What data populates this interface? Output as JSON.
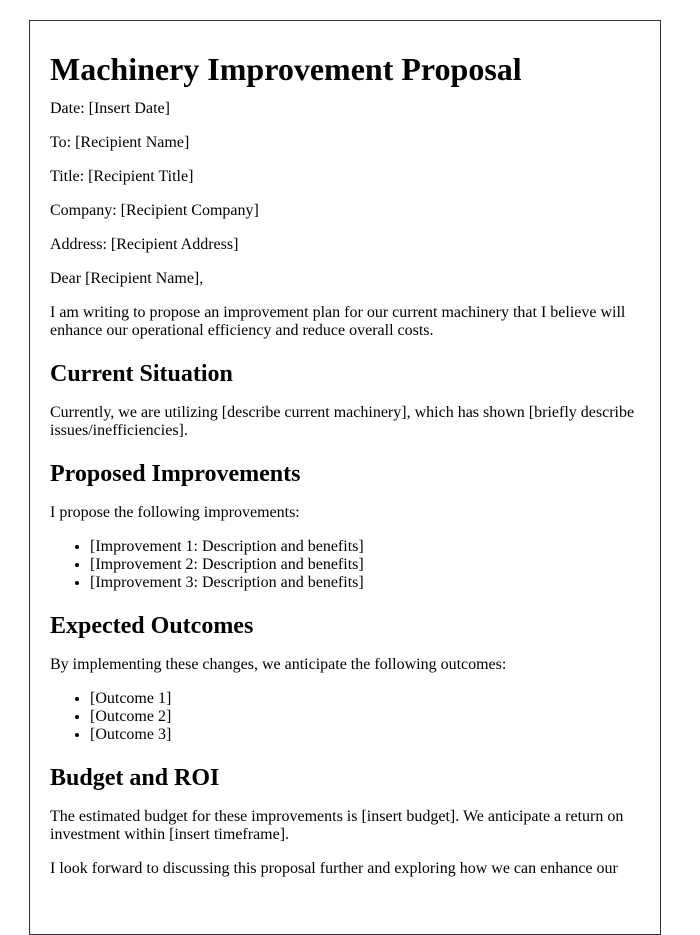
{
  "title": "Machinery Improvement Proposal",
  "meta": [
    "Date: [Insert Date]",
    "To: [Recipient Name]",
    "Title: [Recipient Title]",
    "Company: [Recipient Company]",
    "Address: [Recipient Address]"
  ],
  "salutation": "Dear [Recipient Name],",
  "intro": "I am writing to propose an improvement plan for our current machinery that I believe will enhance our operational efficiency and reduce overall costs.",
  "sections": {
    "current": {
      "heading": "Current Situation",
      "text": "Currently, we are utilizing [describe current machinery], which has shown [briefly describe issues/inefficiencies]."
    },
    "improvements": {
      "heading": "Proposed Improvements",
      "text": "I propose the following improvements:",
      "items": [
        "[Improvement 1: Description and benefits]",
        "[Improvement 2: Description and benefits]",
        "[Improvement 3: Description and benefits]"
      ]
    },
    "outcomes": {
      "heading": "Expected Outcomes",
      "text": "By implementing these changes, we anticipate the following outcomes:",
      "items": [
        "[Outcome 1]",
        "[Outcome 2]",
        "[Outcome 3]"
      ]
    },
    "budget": {
      "heading": "Budget and ROI",
      "text": "The estimated budget for these improvements is [insert budget]. We anticipate a return on investment within [insert timeframe]."
    }
  },
  "closing": "I look forward to discussing this proposal further and exploring how we can enhance our"
}
